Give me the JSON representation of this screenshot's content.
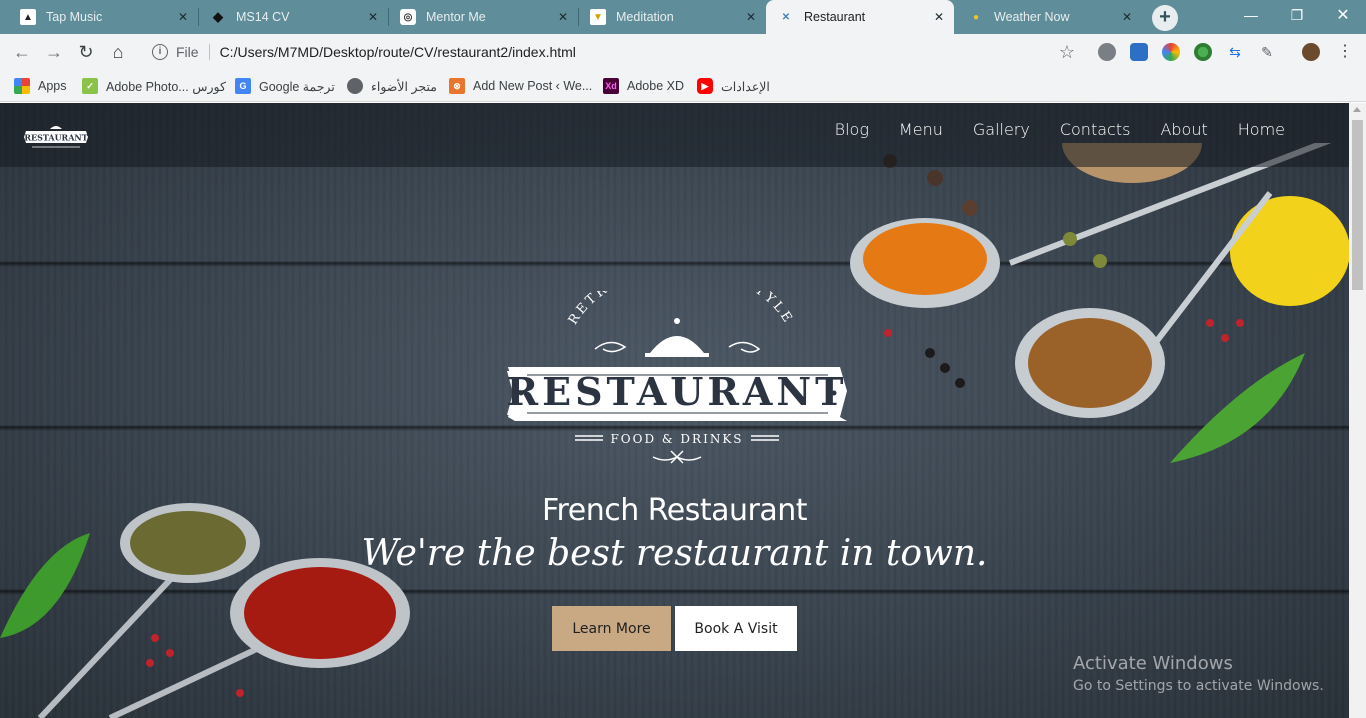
{
  "tabs": [
    {
      "title": "Tap Music",
      "icon": "tap-music-icon"
    },
    {
      "title": "MS14 CV",
      "icon": "ms14-icon"
    },
    {
      "title": "Mentor Me",
      "icon": "mentor-icon"
    },
    {
      "title": "Meditation",
      "icon": "meditation-icon"
    },
    {
      "title": "Restaurant",
      "icon": "restaurant-icon",
      "active": true
    },
    {
      "title": "Weather Now",
      "icon": "weather-icon"
    }
  ],
  "address_bar": {
    "scheme_label": "File",
    "url": "C:/Users/M7MD/Desktop/route/CV/restaurant2/index.html"
  },
  "bookmarks": [
    {
      "label": "Apps",
      "icon": "apps-icon"
    },
    {
      "label": "Adobe Photo... كورس",
      "icon": "photoshop-icon"
    },
    {
      "label": "Google ترجمة",
      "icon": "translate-icon"
    },
    {
      "label": "متجر الأضواء",
      "icon": "globe-icon"
    },
    {
      "label": "Add New Post ‹ We...",
      "icon": "wordpress-icon"
    },
    {
      "label": "Adobe XD",
      "icon": "xd-icon"
    },
    {
      "label": "الإعدادات",
      "icon": "youtube-icon"
    }
  ],
  "site": {
    "nav": [
      "Blog",
      "Menu",
      "Gallery",
      "Contacts",
      "About",
      "Home"
    ],
    "logo": {
      "arc_text": "RETRO AUTHENTIC STYLE",
      "name": "RESTAURANT",
      "tagline": "FOOD & DRINKS"
    },
    "small_logo_name": "RESTAURANT",
    "hero_title": "French Restaurant",
    "hero_subtitle": "We're the best restaurant in town.",
    "buttons": {
      "primary": "Learn More",
      "secondary": "Book A Visit"
    }
  },
  "watermark": {
    "line1": "Activate Windows",
    "line2": "Go to Settings to activate Windows."
  },
  "colors": {
    "tabstrip": "#5f8d99",
    "accent_button": "#c9a983",
    "board": "#3a4550"
  }
}
